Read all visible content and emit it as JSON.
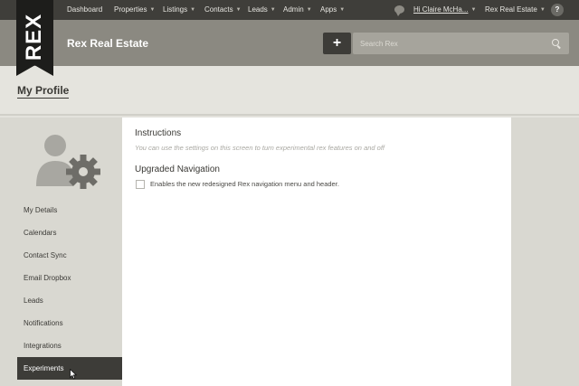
{
  "topnav": {
    "items": [
      {
        "label": "Dashboard",
        "caret": false
      },
      {
        "label": "Properties",
        "caret": true
      },
      {
        "label": "Listings",
        "caret": true
      },
      {
        "label": "Contacts",
        "caret": true
      },
      {
        "label": "Leads",
        "caret": true
      },
      {
        "label": "Admin",
        "caret": true
      },
      {
        "label": "Apps",
        "caret": true
      }
    ],
    "user_greeting": "Hi Claire McHa...",
    "account": "Rex Real Estate",
    "help": "?",
    "icons": {
      "chat": "chat-bubble-icon",
      "help": "help-icon"
    }
  },
  "header": {
    "logo": "REX",
    "title": "Rex Real Estate",
    "add_label": "+",
    "search_placeholder": "Search Rex",
    "search_icon": "search-icon"
  },
  "page": {
    "title": "My Profile"
  },
  "sidebar": {
    "avatar_icon": "user-settings-icon",
    "items": [
      {
        "label": "My Details"
      },
      {
        "label": "Calendars"
      },
      {
        "label": "Contact Sync"
      },
      {
        "label": "Email Dropbox"
      },
      {
        "label": "Leads"
      },
      {
        "label": "Notifications"
      },
      {
        "label": "Integrations"
      },
      {
        "label": "Experiments",
        "active": true
      }
    ]
  },
  "main": {
    "instructions_heading": "Instructions",
    "instructions_text": "You can use the settings on this screen to turn experimental rex features on and off",
    "upgraded_heading": "Upgraded Navigation",
    "upgraded_option": "Enables the new redesigned Rex navigation menu and header.",
    "upgraded_checked": false
  },
  "colors": {
    "nav_bg": "#3f3e3a",
    "header_bg": "#8b8981",
    "sidebar_bg": "#d9d8d1",
    "active_item_bg": "#3d3c38"
  }
}
